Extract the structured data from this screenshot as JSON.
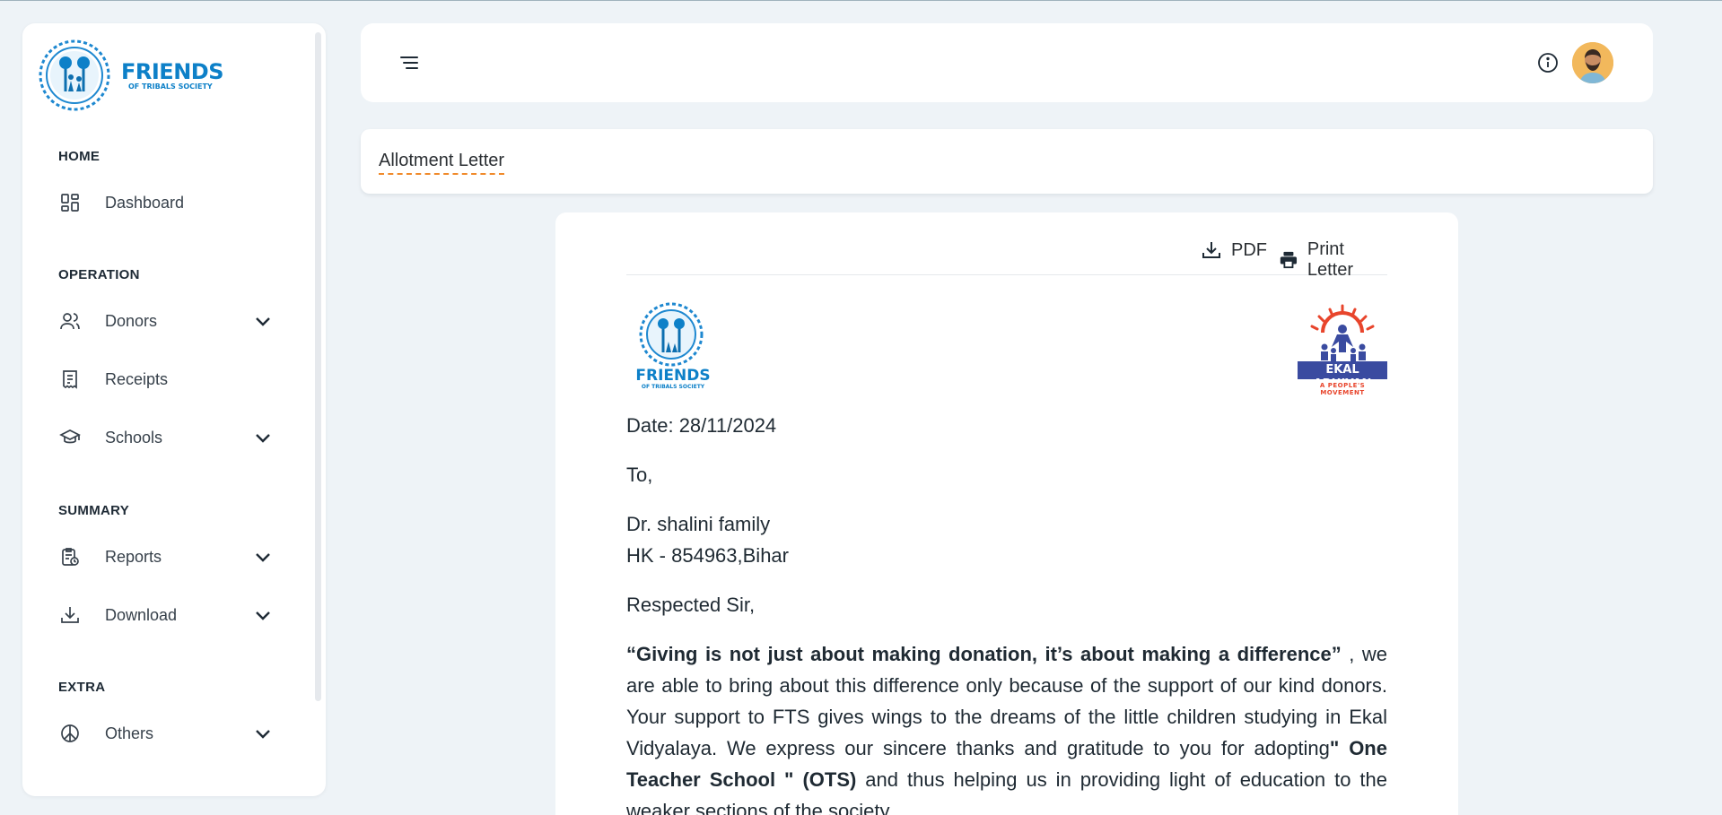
{
  "brand": {
    "name": "FRIENDS",
    "tagline": "OF TRIBALS SOCIETY"
  },
  "sidebar": {
    "sections": [
      {
        "title": "HOME"
      },
      {
        "title": "OPERATION"
      },
      {
        "title": "SUMMARY"
      },
      {
        "title": "EXTRA"
      }
    ],
    "items": [
      {
        "label": "Dashboard",
        "icon": "dashboard-icon",
        "expandable": false
      },
      {
        "label": "Donors",
        "icon": "users-icon",
        "expandable": true
      },
      {
        "label": "Receipts",
        "icon": "receipt-icon",
        "expandable": false
      },
      {
        "label": "Schools",
        "icon": "graduation-cap-icon",
        "expandable": true
      },
      {
        "label": "Reports",
        "icon": "report-icon",
        "expandable": true
      },
      {
        "label": "Download",
        "icon": "download-icon",
        "expandable": true
      },
      {
        "label": "Others",
        "icon": "peace-icon",
        "expandable": true
      }
    ]
  },
  "header": {
    "menu_icon": "menu-icon",
    "info_icon": "info-icon",
    "avatar_icon": "user-avatar"
  },
  "page": {
    "title": "Allotment Letter"
  },
  "letter": {
    "actions": {
      "pdf_label": "PDF",
      "print_label": "Print Letter"
    },
    "logos": {
      "left": {
        "name": "FRIENDS",
        "tagline": "OF TRIBALS SOCIETY"
      },
      "right": {
        "name": "EKAL ABHIYAN",
        "tagline": "A PEOPLE'S MOVEMENT"
      }
    },
    "date": "Date: 28/11/2024",
    "to": "To,",
    "recipient_name": "Dr. shalini family",
    "recipient_address": "HK - 854963,Bihar",
    "salutation": "Respected Sir,",
    "body": {
      "quote": "“Giving is not just about making donation, it’s about making a difference”",
      "part1": " , we are able to bring about this difference only because of the support of our kind donors. Your support to FTS gives wings to the dreams of the little children studying in Ekal Vidyalaya. We express our sincere thanks and gratitude to you for adopting",
      "ots": "\" One Teacher School \" (OTS)",
      "part2": " and thus helping us in providing light of education to the weaker sections of the society."
    }
  },
  "colors": {
    "brand_blue": "#0d80c8",
    "accent_orange": "#f08a2b",
    "page_bg": "#eef3f7"
  }
}
